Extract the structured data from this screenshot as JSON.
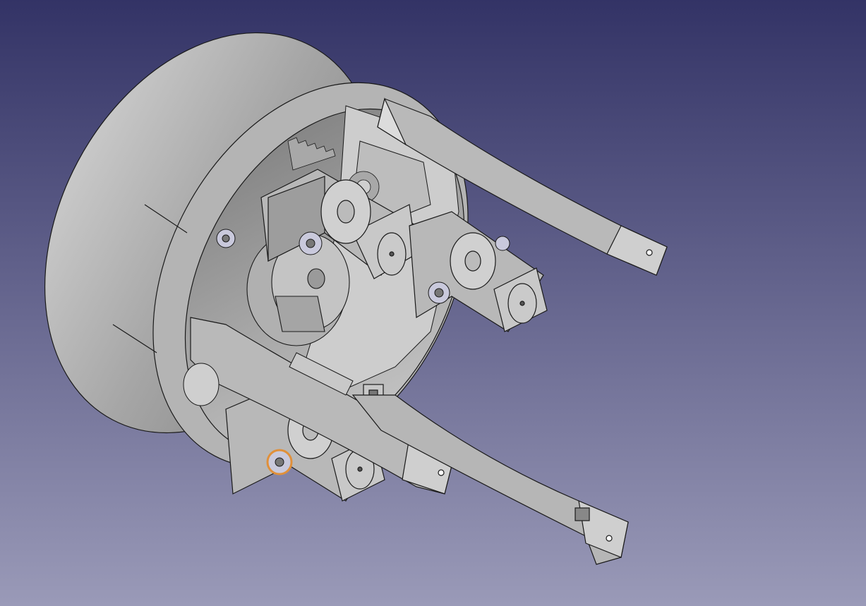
{
  "viewport": {
    "background_top": "#333366",
    "background_bottom": "#9a9ab8"
  },
  "model": {
    "part_fill": "#b9b9b9",
    "part_shadow": "#8c8c8c",
    "part_light": "#dcdcdc",
    "edge_color": "#1a1a1a",
    "screw_color": "#c9c9dc",
    "accent_ring": "#e0903a"
  }
}
